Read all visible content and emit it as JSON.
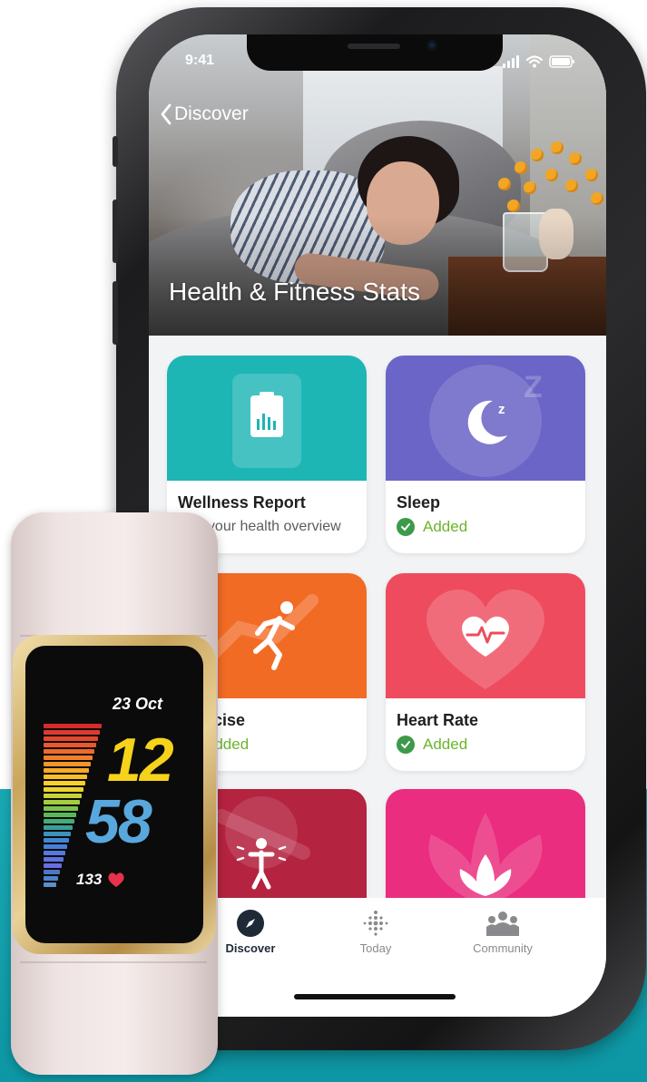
{
  "status_bar": {
    "time": "9:41"
  },
  "nav": {
    "back_label": "Discover"
  },
  "hero": {
    "title": "Health & Fitness Stats"
  },
  "cards": [
    {
      "title": "Wellness Report",
      "subtitle": "See your health overview",
      "color": "#1eb5b5",
      "icon": "clipboard-chart-icon"
    },
    {
      "title": "Sleep",
      "status": "Added",
      "color": "#6a65c6",
      "icon": "moon-zzz-icon"
    },
    {
      "title": "Exercise",
      "status": "Added",
      "color": "#f26b25",
      "icon": "runner-icon"
    },
    {
      "title": "Heart Rate",
      "status": "Added",
      "color": "#ee4c5e",
      "icon": "heart-pulse-icon"
    },
    {
      "title": "",
      "color": "#b4233f",
      "icon": "person-stretch-icon"
    },
    {
      "title": "",
      "color": "#ea2d7e",
      "icon": "lotus-icon"
    }
  ],
  "tab_bar": {
    "items": [
      {
        "label": "Discover",
        "icon": "compass-icon",
        "active": true
      },
      {
        "label": "Today",
        "icon": "dots-grid-icon",
        "active": false
      },
      {
        "label": "Community",
        "icon": "people-icon",
        "active": false
      }
    ]
  },
  "watch": {
    "date": "23 Oct",
    "hour": "12",
    "minute": "58",
    "heart_rate": "133"
  },
  "colors": {
    "added_green": "#6bb52b",
    "accent_teal": "#0d96a3",
    "watch_hour_yellow": "#f6d21b",
    "watch_minute_blue": "#59a8dd"
  }
}
